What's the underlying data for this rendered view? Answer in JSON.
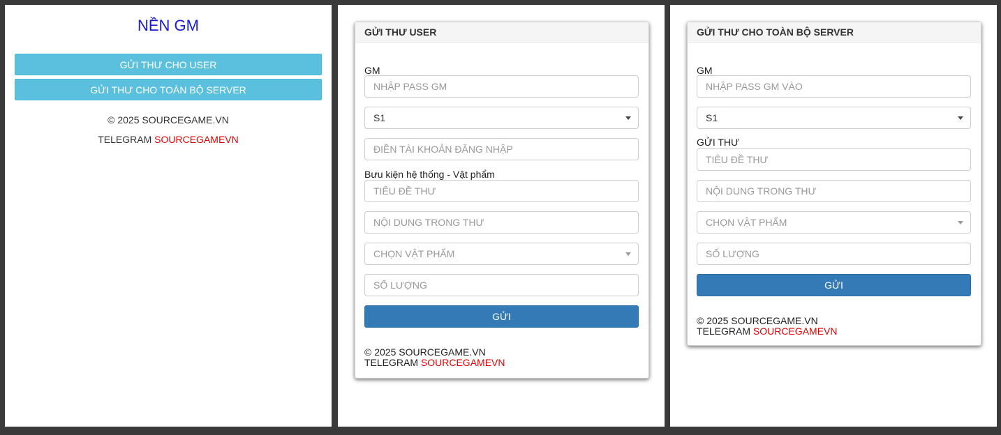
{
  "left": {
    "title": "NỀN GM",
    "btn_user": "GỬI THƯ CHO USER",
    "btn_server": "GỬI THƯ CHO TOÀN BỘ SERVER",
    "copyright": "© 2025 SOURCEGAME.VN",
    "telegram_label": "TELEGRAM ",
    "telegram_handle": "SOURCEGAMEVN"
  },
  "user_form": {
    "header": "GỬI THƯ USER",
    "gm_label": "GM",
    "gm_placeholder": "NHẬP PASS GM",
    "server_value": "S1",
    "account_placeholder": "ĐIỀN TÀI KHOẢN ĐĂNG NHẬP",
    "mail_label": "Bưu kiện hệ thống - Vật phẩm",
    "title_placeholder": "TIÊU ĐỀ THƯ",
    "content_placeholder": "NỘI DUNG TRONG THƯ",
    "item_placeholder": "CHỌN VẬT PHẨM",
    "qty_placeholder": "SỐ LƯỢNG",
    "send": "GỬI",
    "copyright": "© 2025 SOURCEGAME.VN",
    "telegram_label": "TELEGRAM ",
    "telegram_handle": "SOURCEGAMEVN"
  },
  "server_form": {
    "header": "GỬI THƯ CHO TOÀN BỘ SERVER",
    "gm_label": "GM",
    "gm_placeholder": "NHẬP PASS GM VÀO",
    "server_value": "S1",
    "mail_label": "GỬI THƯ",
    "title_placeholder": "TIÊU ĐỀ THƯ",
    "content_placeholder": "NỘI DUNG TRONG THƯ",
    "item_placeholder": "CHỌN VẬT PHẨM",
    "qty_placeholder": "SỐ LƯỢNG",
    "send": "GỬI",
    "copyright": "© 2025 SOURCEGAME.VN",
    "telegram_label": "TELEGRAM ",
    "telegram_handle": "SOURCEGAMEVN"
  },
  "colors": {
    "title_blue": "#1a1ad6",
    "info_button": "#5bc0de",
    "primary_button": "#337ab7",
    "telegram_red": "#e00000",
    "frame_gray": "#3a3a3a"
  }
}
